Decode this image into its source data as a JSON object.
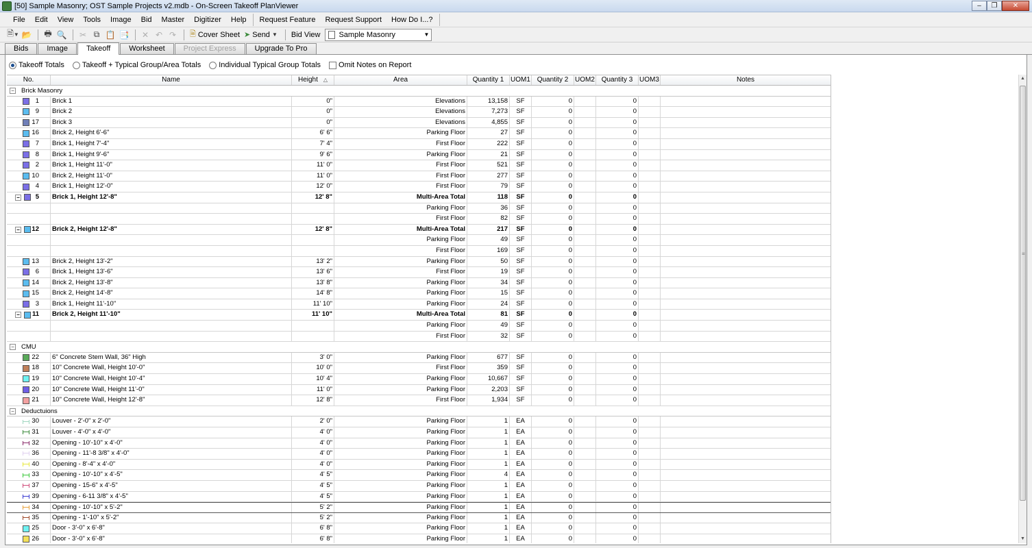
{
  "window": {
    "title": "[50] Sample Masonry; OST Sample Projects v2.mdb - On-Screen Takeoff PlanViewer"
  },
  "menu": [
    "File",
    "Edit",
    "View",
    "Tools",
    "Image",
    "Bid",
    "Master",
    "Digitizer",
    "Help"
  ],
  "menu_links": [
    "Request Feature",
    "Request Support",
    "How Do I...?"
  ],
  "toolbar": {
    "cover_sheet": "Cover Sheet",
    "send": "Send",
    "bid_view_label": "Bid View",
    "bid_view_value": "Sample Masonry"
  },
  "tabs": [
    {
      "label": "Bids",
      "state": "normal"
    },
    {
      "label": "Image",
      "state": "normal"
    },
    {
      "label": "Takeoff",
      "state": "active"
    },
    {
      "label": "Worksheet",
      "state": "normal"
    },
    {
      "label": "Project Express",
      "state": "disabled"
    },
    {
      "label": "Upgrade To Pro",
      "state": "normal"
    }
  ],
  "options": {
    "takeoff_totals": "Takeoff Totals",
    "takeoff_typical": "Takeoff + Typical Group/Area Totals",
    "individual_typical": "Individual Typical Group Totals",
    "omit_notes": "Omit Notes on Report"
  },
  "columns": [
    "No.",
    "Name",
    "Height",
    "Area",
    "Quantity 1",
    "UOM1",
    "Quantity 2",
    "UOM2",
    "Quantity 3",
    "UOM3",
    "Notes"
  ],
  "groups": [
    {
      "name": "Brick Masonry",
      "rows": [
        {
          "kind": "item",
          "color": "#7b6fe6",
          "no": "1",
          "name": "Brick 1",
          "height": "0\"",
          "area": "Elevations",
          "q1": "13,158",
          "u1": "SF",
          "q2": "0",
          "q3": "0"
        },
        {
          "kind": "item",
          "color": "#5bbcef",
          "no": "9",
          "name": "Brick 2",
          "height": "0\"",
          "area": "Elevations",
          "q1": "7,273",
          "u1": "SF",
          "q2": "0",
          "q3": "0"
        },
        {
          "kind": "item",
          "color": "#6f7fb8",
          "no": "17",
          "name": "Brick 3",
          "height": "0\"",
          "area": "Elevations",
          "q1": "4,855",
          "u1": "SF",
          "q2": "0",
          "q3": "0"
        },
        {
          "kind": "item",
          "color": "#5bbcef",
          "no": "16",
          "name": "Brick 2, Height 6'-6\"",
          "height": "6' 6\"",
          "area": "Parking Floor",
          "q1": "27",
          "u1": "SF",
          "q2": "0",
          "q3": "0"
        },
        {
          "kind": "item",
          "color": "#7b6fe6",
          "no": "7",
          "name": "Brick 1, Height 7'-4\"",
          "height": "7' 4\"",
          "area": "First Floor",
          "q1": "222",
          "u1": "SF",
          "q2": "0",
          "q3": "0"
        },
        {
          "kind": "item",
          "color": "#7b6fe6",
          "no": "8",
          "name": "Brick 1, Height 9'-6\"",
          "height": "9' 6\"",
          "area": "Parking Floor",
          "q1": "21",
          "u1": "SF",
          "q2": "0",
          "q3": "0"
        },
        {
          "kind": "item",
          "color": "#7b6fe6",
          "no": "2",
          "name": "Brick 1, Height 11'-0\"",
          "height": "11' 0\"",
          "area": "First Floor",
          "q1": "521",
          "u1": "SF",
          "q2": "0",
          "q3": "0"
        },
        {
          "kind": "item",
          "color": "#5bbcef",
          "no": "10",
          "name": "Brick 2, Height 11'-0\"",
          "height": "11' 0\"",
          "area": "First Floor",
          "q1": "277",
          "u1": "SF",
          "q2": "0",
          "q3": "0"
        },
        {
          "kind": "item",
          "color": "#7b6fe6",
          "no": "4",
          "name": "Brick 1, Height 12'-0\"",
          "height": "12' 0\"",
          "area": "First Floor",
          "q1": "79",
          "u1": "SF",
          "q2": "0",
          "q3": "0"
        },
        {
          "kind": "total",
          "color": "#7b6fe6",
          "no": "5",
          "name": "Brick 1, Height 12'-8\"",
          "height": "12' 8\"",
          "area": "Multi-Area Total",
          "q1": "118",
          "u1": "SF",
          "q2": "0",
          "q3": "0"
        },
        {
          "kind": "sub",
          "area": "Parking Floor",
          "q1": "36",
          "u1": "SF",
          "q2": "0",
          "q3": "0"
        },
        {
          "kind": "sub",
          "area": "First Floor",
          "q1": "82",
          "u1": "SF",
          "q2": "0",
          "q3": "0"
        },
        {
          "kind": "total",
          "color": "#5bbcef",
          "no": "12",
          "name": "Brick 2, Height 12'-8\"",
          "height": "12' 8\"",
          "area": "Multi-Area Total",
          "q1": "217",
          "u1": "SF",
          "q2": "0",
          "q3": "0"
        },
        {
          "kind": "sub",
          "area": "Parking Floor",
          "q1": "49",
          "u1": "SF",
          "q2": "0",
          "q3": "0"
        },
        {
          "kind": "sub",
          "area": "First Floor",
          "q1": "169",
          "u1": "SF",
          "q2": "0",
          "q3": "0"
        },
        {
          "kind": "item",
          "color": "#5bbcef",
          "no": "13",
          "name": "Brick 2, Height 13'-2\"",
          "height": "13' 2\"",
          "area": "Parking Floor",
          "q1": "50",
          "u1": "SF",
          "q2": "0",
          "q3": "0"
        },
        {
          "kind": "item",
          "color": "#7b6fe6",
          "no": "6",
          "name": "Brick 1, Height 13'-6\"",
          "height": "13' 6\"",
          "area": "First Floor",
          "q1": "19",
          "u1": "SF",
          "q2": "0",
          "q3": "0"
        },
        {
          "kind": "item",
          "color": "#5bbcef",
          "no": "14",
          "name": "Brick 2, Height 13'-8\"",
          "height": "13' 8\"",
          "area": "Parking Floor",
          "q1": "34",
          "u1": "SF",
          "q2": "0",
          "q3": "0"
        },
        {
          "kind": "item",
          "color": "#5bbcef",
          "no": "15",
          "name": "Brick 2, Height 14'-8\"",
          "height": "14' 8\"",
          "area": "Parking Floor",
          "q1": "15",
          "u1": "SF",
          "q2": "0",
          "q3": "0"
        },
        {
          "kind": "item",
          "color": "#7b6fe6",
          "no": "3",
          "name": "Brick 1, Height 11'-10\"",
          "height": "11' 10\"",
          "area": "Parking Floor",
          "q1": "24",
          "u1": "SF",
          "q2": "0",
          "q3": "0"
        },
        {
          "kind": "total",
          "color": "#5bbcef",
          "no": "11",
          "name": "Brick 2, Height 11'-10\"",
          "height": "11' 10\"",
          "area": "Multi-Area Total",
          "q1": "81",
          "u1": "SF",
          "q2": "0",
          "q3": "0"
        },
        {
          "kind": "sub",
          "area": "Parking Floor",
          "q1": "49",
          "u1": "SF",
          "q2": "0",
          "q3": "0"
        },
        {
          "kind": "sub",
          "area": "First Floor",
          "q1": "32",
          "u1": "SF",
          "q2": "0",
          "q3": "0"
        }
      ]
    },
    {
      "name": "CMU",
      "rows": [
        {
          "kind": "item",
          "color": "#5aaa5a",
          "no": "22",
          "name": "6\" Concrete Stem Wall, 36\" High",
          "height": "3' 0\"",
          "area": "Parking Floor",
          "q1": "677",
          "u1": "SF",
          "q2": "0",
          "q3": "0"
        },
        {
          "kind": "item",
          "color": "#c0805a",
          "no": "18",
          "name": "10\" Concrete Wall, Height 10'-0\"",
          "height": "10' 0\"",
          "area": "First Floor",
          "q1": "359",
          "u1": "SF",
          "q2": "0",
          "q3": "0"
        },
        {
          "kind": "item",
          "color": "#6ff2f2",
          "no": "19",
          "name": "10\" Concrete Wall, Height 10'-4\"",
          "height": "10' 4\"",
          "area": "Parking Floor",
          "q1": "10,667",
          "u1": "SF",
          "q2": "0",
          "q3": "0"
        },
        {
          "kind": "item",
          "color": "#6f5fe6",
          "no": "20",
          "name": "10\" Concrete Wall, Height 11'-0\"",
          "height": "11' 0\"",
          "area": "Parking Floor",
          "q1": "2,203",
          "u1": "SF",
          "q2": "0",
          "q3": "0"
        },
        {
          "kind": "item",
          "color": "#f2a0a0",
          "no": "21",
          "name": "10\" Concrete Wall, Height 12'-8\"",
          "height": "12' 8\"",
          "area": "First Floor",
          "q1": "1,934",
          "u1": "SF",
          "q2": "0",
          "q3": "0"
        }
      ]
    },
    {
      "name": "Deductuions",
      "rows": [
        {
          "kind": "line",
          "color": "#9fd6c0",
          "no": "30",
          "name": "Louver - 2'-0\" x 2'-0\"",
          "height": "2' 0\"",
          "area": "Parking Floor",
          "q1": "1",
          "u1": "EA",
          "q2": "0",
          "q3": "0"
        },
        {
          "kind": "line",
          "color": "#3a8a3a",
          "no": "31",
          "name": "Louver - 4'-0\" x 4'-0\"",
          "height": "4' 0\"",
          "area": "Parking Floor",
          "q1": "1",
          "u1": "EA",
          "q2": "0",
          "q3": "0"
        },
        {
          "kind": "line",
          "color": "#8a2a6a",
          "no": "32",
          "name": "Opening - 10'-10\" x 4'-0\"",
          "height": "4' 0\"",
          "area": "Parking Floor",
          "q1": "1",
          "u1": "EA",
          "q2": "0",
          "q3": "0"
        },
        {
          "kind": "line",
          "color": "#e0d0f0",
          "no": "36",
          "name": "Opening - 11'-8 3/8\" x 4'-0\"",
          "height": "4' 0\"",
          "area": "Parking Floor",
          "q1": "1",
          "u1": "EA",
          "q2": "0",
          "q3": "0"
        },
        {
          "kind": "line",
          "color": "#e8e83a",
          "no": "40",
          "name": "Opening - 8'-4\" x 4'-0\"",
          "height": "4' 0\"",
          "area": "Parking Floor",
          "q1": "1",
          "u1": "EA",
          "q2": "0",
          "q3": "0"
        },
        {
          "kind": "line",
          "color": "#3ac83a",
          "no": "33",
          "name": "Opening - 10'-10\" x 4'-5\"",
          "height": "4' 5\"",
          "area": "Parking Floor",
          "q1": "4",
          "u1": "EA",
          "q2": "0",
          "q3": "0"
        },
        {
          "kind": "line",
          "color": "#d04a7a",
          "no": "37",
          "name": "Opening - 15-6\" x 4'-5\"",
          "height": "4' 5\"",
          "area": "Parking Floor",
          "q1": "1",
          "u1": "EA",
          "q2": "0",
          "q3": "0"
        },
        {
          "kind": "line",
          "color": "#3a3ad0",
          "no": "39",
          "name": "Opening - 6-11 3/8\" x 4'-5\"",
          "height": "4' 5\"",
          "area": "Parking Floor",
          "q1": "1",
          "u1": "EA",
          "q2": "0",
          "q3": "0"
        },
        {
          "kind": "line",
          "color": "#e8a03a",
          "no": "34",
          "name": "Opening - 10'-10\" x 5'-2\"",
          "height": "5' 2\"",
          "area": "Parking Floor",
          "q1": "1",
          "u1": "EA",
          "q2": "0",
          "q3": "0",
          "selected": true
        },
        {
          "kind": "line",
          "color": "#a04a2a",
          "no": "35",
          "name": "Opening - 1'-10\" x 5'-2\"",
          "height": "5' 2\"",
          "area": "Parking Floor",
          "q1": "1",
          "u1": "EA",
          "q2": "0",
          "q3": "0"
        },
        {
          "kind": "item",
          "color": "#6ff2f2",
          "no": "25",
          "name": "Door - 3'-0\" x 6'-8\"",
          "height": "6' 8\"",
          "area": "Parking Floor",
          "q1": "1",
          "u1": "EA",
          "q2": "0",
          "q3": "0"
        },
        {
          "kind": "item",
          "color": "#f2e05a",
          "no": "26",
          "name": "Door - 3'-0\" x 6'-8\"",
          "height": "6' 8\"",
          "area": "Parking Floor",
          "q1": "1",
          "u1": "EA",
          "q2": "0",
          "q3": "0"
        }
      ]
    }
  ]
}
